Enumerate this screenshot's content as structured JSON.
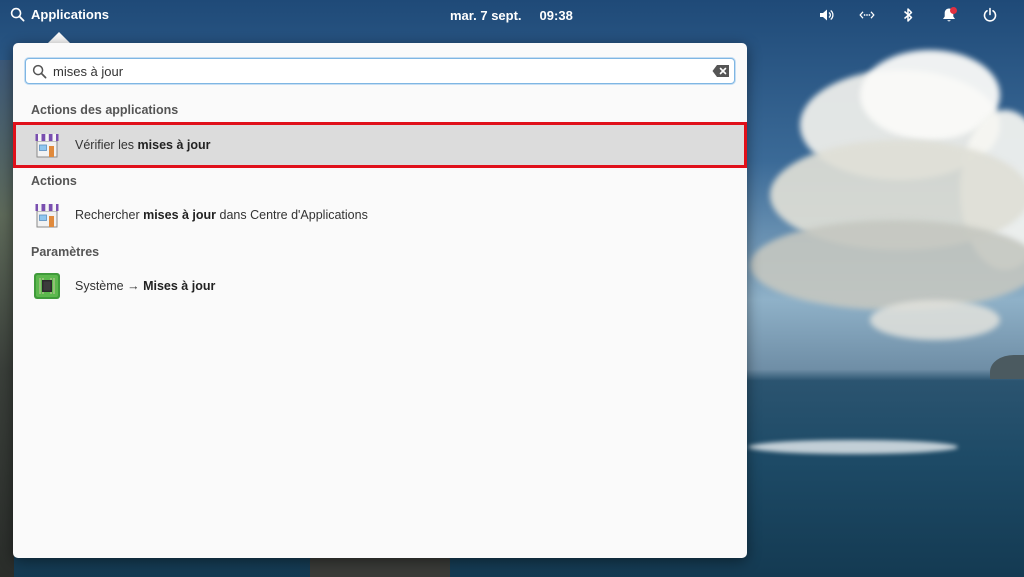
{
  "panel": {
    "applications_label": "Applications",
    "date": "mar. 7 sept.",
    "time": "09:38",
    "icons": [
      "volume-icon",
      "network-icon",
      "bluetooth-icon",
      "notifications-icon",
      "power-icon"
    ]
  },
  "search": {
    "value": "mises à jour"
  },
  "sections": [
    {
      "title": "Actions des applications",
      "items": [
        {
          "icon": "appcenter-icon",
          "prefix": "Vérifier les ",
          "bold": "mises à jour",
          "suffix": ""
        }
      ]
    },
    {
      "title": "Actions",
      "items": [
        {
          "icon": "appcenter-icon",
          "prefix": "Rechercher ",
          "bold": "mises à jour",
          "suffix": " dans Centre d'Applications"
        }
      ]
    },
    {
      "title": "Paramètres",
      "items": [
        {
          "icon": "system-chip-icon",
          "prefix": "Système → ",
          "bold": "Mises à jour",
          "suffix": ""
        }
      ]
    }
  ],
  "colors": {
    "highlight_border": "#e0101a",
    "selected_row": "#dcdcdc",
    "search_focus": "#7fb6e3",
    "notification_dot": "#e03040"
  }
}
